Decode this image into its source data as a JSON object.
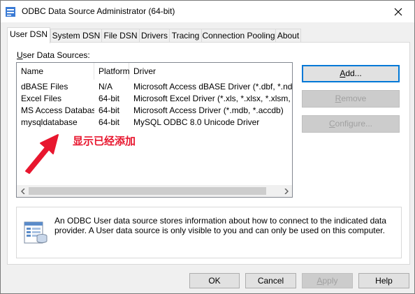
{
  "window": {
    "title": "ODBC Data Source Administrator (64-bit)"
  },
  "tabs": [
    {
      "label": "User DSN"
    },
    {
      "label": "System DSN"
    },
    {
      "label": "File DSN"
    },
    {
      "label": "Drivers"
    },
    {
      "label": "Tracing"
    },
    {
      "label": "Connection Pooling"
    },
    {
      "label": "About"
    }
  ],
  "user_dsn": {
    "group_label_first": "U",
    "group_label_rest": "ser Data Sources:",
    "columns": [
      "Name",
      "Platform",
      "Driver"
    ],
    "rows": [
      {
        "name": "dBASE Files",
        "platform": "N/A",
        "driver": "Microsoft Access dBASE Driver (*.dbf, *.ndx, *.m"
      },
      {
        "name": "Excel Files",
        "platform": "64-bit",
        "driver": "Microsoft Excel Driver (*.xls, *.xlsx, *.xlsm, *.xlsb)"
      },
      {
        "name": "MS Access Database",
        "platform": "64-bit",
        "driver": "Microsoft Access Driver (*.mdb, *.accdb)"
      },
      {
        "name": "mysqldatabase",
        "platform": "64-bit",
        "driver": "MySQL ODBC 8.0 Unicode Driver"
      }
    ],
    "annotation": "显示已经添加",
    "buttons": {
      "add_first": "A",
      "add_rest": "dd...",
      "remove_first": "R",
      "remove_rest": "emove",
      "configure_first": "C",
      "configure_rest": "onfigure..."
    },
    "info_text": "An ODBC User data source stores information about how to connect to the indicated data provider.   A User data source is only visible to you and can only be used on this computer."
  },
  "footer": {
    "ok": "OK",
    "cancel": "Cancel",
    "apply_first": "A",
    "apply_rest": "pply",
    "help": "Help"
  },
  "colors": {
    "annotation": "#e8162e",
    "default_button_border": "#0078d7"
  }
}
